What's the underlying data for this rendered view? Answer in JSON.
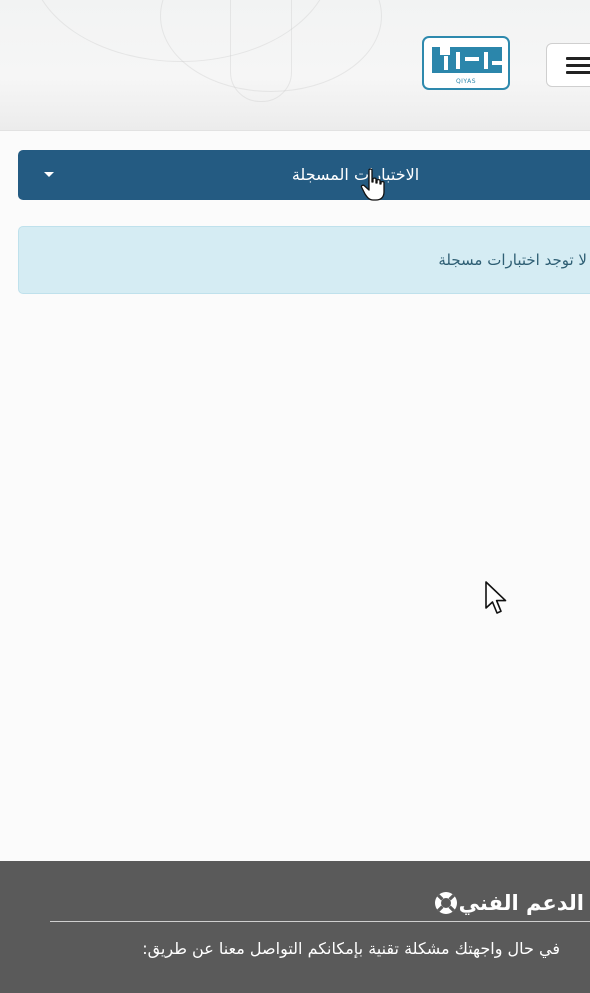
{
  "header": {
    "logo_caption": "QIYAS",
    "menu_icon": "hamburger-menu-icon"
  },
  "tests_dropdown": {
    "label": "الاختبارات المسجلة",
    "caret_icon": "caret-down-icon"
  },
  "alert": {
    "message": "لا توجد اختبارات مسجلة"
  },
  "footer": {
    "support_icon": "lifebuoy-icon",
    "support_title": "الدعم الفني",
    "support_text": "في حال واجهتك مشكلة تقنية بإمكانكم التواصل معنا عن طريق:"
  },
  "colors": {
    "dropdown_bg": "#245b82",
    "alert_bg": "#d5ecf3",
    "alert_text": "#2f5f74",
    "footer_bg": "#5a5a5a",
    "logo_blue": "#2b86ab"
  }
}
